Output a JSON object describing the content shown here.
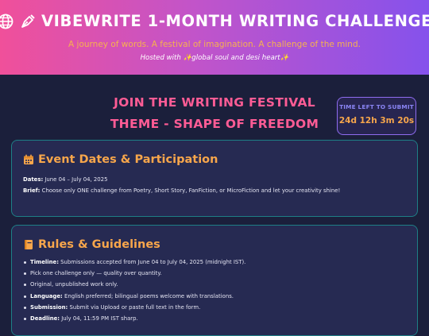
{
  "header": {
    "title": "VIBEWRITE 1-MONTH WRITING CHALLENGE",
    "tagline": "A journey of words. A festival of imagination. A challenge of the mind.",
    "hosted": "Hosted with ✨global soul and desi heart✨",
    "icons": [
      "globe-icon",
      "pen-nib-icon"
    ]
  },
  "hero": {
    "line1": "JOIN THE WRITING FESTIVAL",
    "line2": "THEME - SHAPE OF FREEDOM"
  },
  "countdown": {
    "label": "TIME LEFT TO SUBMIT",
    "value": "24d 12h 3m 20s"
  },
  "events": {
    "icon": "calendar-icon",
    "title": "Event Dates & Participation",
    "dates_label": "Dates:",
    "dates_value": " June 04 – July 04, 2025",
    "brief_label": "Brief:",
    "brief_value": " Choose only ONE challenge from Poetry, Short Story, FanFiction, or MicroFiction and let your creativity shine!"
  },
  "rules": {
    "icon": "book-icon",
    "title": "Rules & Guidelines",
    "items": [
      {
        "label": "Timeline:",
        "text": " Submissions accepted from June 04 to July 04, 2025 (midnight IST)."
      },
      {
        "label": "",
        "text": "Pick one challenge only — quality over quantity."
      },
      {
        "label": "",
        "text": "Original, unpublished work only."
      },
      {
        "label": "Language:",
        "text": " English preferred; bilingual poems welcome with translations."
      },
      {
        "label": "Submission:",
        "text": " Submit via Upload or paste full text in the form."
      },
      {
        "label": "Deadline:",
        "text": " July 04, 11:59 PM IST sharp."
      }
    ]
  },
  "colors": {
    "header_gradient": [
      "#f0509a",
      "#c254c9",
      "#8552ec"
    ],
    "background": "#1b1f3b",
    "card": "#262a52",
    "card_border": "#1e7f86",
    "accent_orange": "#f7a64b",
    "accent_pink": "#ff5c95",
    "countdown_border": "#8f6cf0"
  }
}
